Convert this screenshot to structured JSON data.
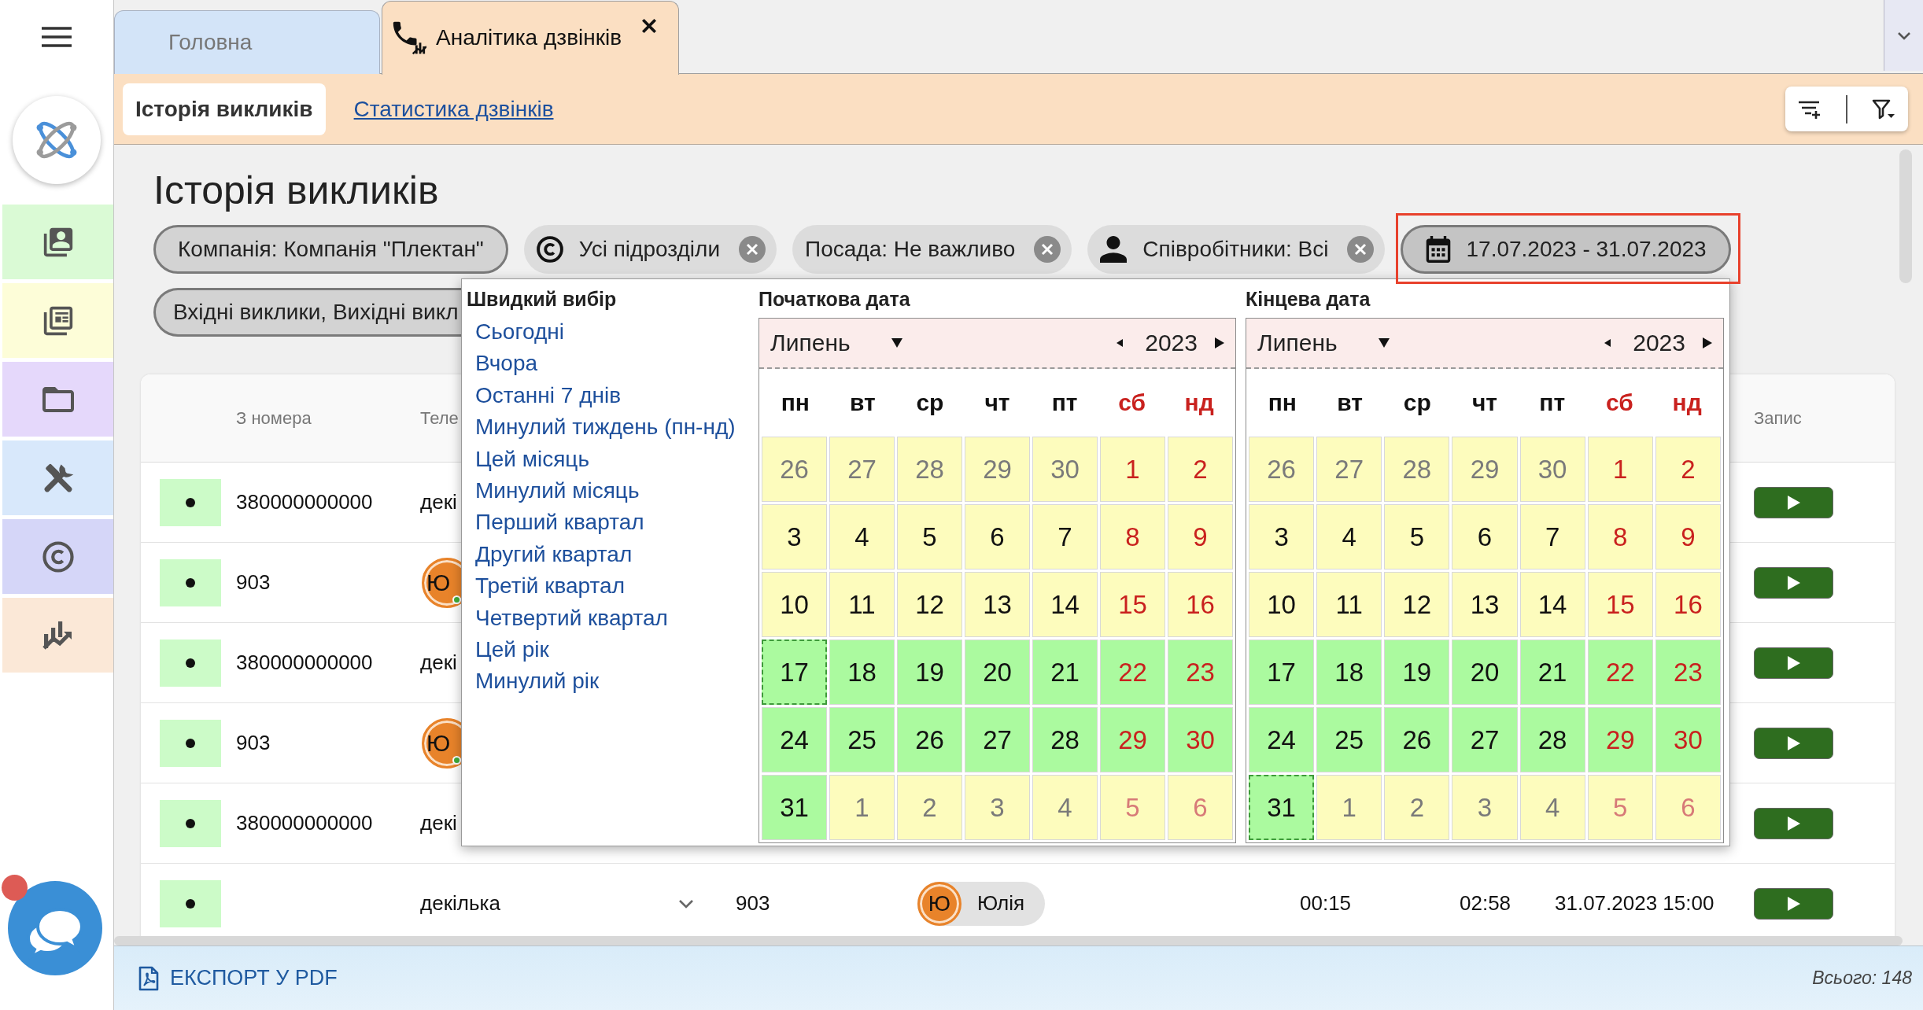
{
  "sidebar": {
    "items": [
      {
        "color": "#dafad5"
      },
      {
        "color": "#fdfdd8"
      },
      {
        "color": "#e5d8fb"
      },
      {
        "color": "#d8e8fb"
      },
      {
        "color": "#d5d6f8"
      },
      {
        "color": "#fbe8d7"
      }
    ]
  },
  "tabs": [
    {
      "label": "Головна",
      "kind": "plain",
      "selected": false,
      "closable": false
    },
    {
      "label": "Аналітика дзвінків",
      "kind": "calls",
      "selected": true,
      "closable": true
    }
  ],
  "subtabs": [
    {
      "label": "Історія викликів",
      "selected": true
    },
    {
      "label": "Статистика дзвінків",
      "selected": false
    }
  ],
  "page_title": "Історія викликів",
  "filters": [
    {
      "kind": "company",
      "label": "Компанія: Компанія \"Плектан\"",
      "removable": false,
      "expanded": false,
      "highlighted": false
    },
    {
      "kind": "division",
      "label": "Усі підрозділи",
      "removable": true,
      "expanded": false,
      "highlighted": false
    },
    {
      "kind": "position",
      "label": "Посада: Не важливо",
      "removable": true,
      "expanded": false,
      "highlighted": false
    },
    {
      "kind": "employees",
      "label": "Співробітники: Всі",
      "removable": true,
      "expanded": false,
      "highlighted": false
    },
    {
      "kind": "period",
      "label": "17.07.2023 - 31.07.2023",
      "removable": false,
      "expanded": true,
      "highlighted": true
    },
    {
      "kind": "call_types",
      "label": "Вхідні виклики, Вихідні викл",
      "removable": false,
      "expanded": false,
      "highlighted": false
    }
  ],
  "date_picker": {
    "quick_select": {
      "title": "Швидкий вибір",
      "items": [
        "Сьогодні",
        "Вчора",
        "Останні 7 днів",
        "Минулий тиждень (пн-нд)",
        "Цей місяць",
        "Минулий місяць",
        "Перший квартал",
        "Другий квартал",
        "Третій квартал",
        "Четвертий квартал",
        "Цей рік",
        "Минулий рік"
      ]
    },
    "calendars": [
      {
        "title": "Початкова дата",
        "month": "Липень",
        "year": "2023",
        "weekdays": [
          {
            "label": "пн",
            "weekend": false
          },
          {
            "label": "вт",
            "weekend": false
          },
          {
            "label": "ср",
            "weekend": false
          },
          {
            "label": "чт",
            "weekend": false
          },
          {
            "label": "пт",
            "weekend": false
          },
          {
            "label": "сб",
            "weekend": true
          },
          {
            "label": "нд",
            "weekend": true
          }
        ],
        "weeks": [
          [
            {
              "day": "26",
              "other_month": true,
              "in_range": false,
              "selected": false
            },
            {
              "day": "27",
              "other_month": true,
              "in_range": false,
              "selected": false
            },
            {
              "day": "28",
              "other_month": true,
              "in_range": false,
              "selected": false
            },
            {
              "day": "29",
              "other_month": true,
              "in_range": false,
              "selected": false
            },
            {
              "day": "30",
              "other_month": true,
              "in_range": false,
              "selected": false
            },
            {
              "day": "1",
              "other_month": false,
              "in_range": false,
              "selected": false
            },
            {
              "day": "2",
              "other_month": false,
              "in_range": false,
              "selected": false
            }
          ],
          [
            {
              "day": "3",
              "other_month": false,
              "in_range": false,
              "selected": false
            },
            {
              "day": "4",
              "other_month": false,
              "in_range": false,
              "selected": false
            },
            {
              "day": "5",
              "other_month": false,
              "in_range": false,
              "selected": false
            },
            {
              "day": "6",
              "other_month": false,
              "in_range": false,
              "selected": false
            },
            {
              "day": "7",
              "other_month": false,
              "in_range": false,
              "selected": false
            },
            {
              "day": "8",
              "other_month": false,
              "in_range": false,
              "selected": false
            },
            {
              "day": "9",
              "other_month": false,
              "in_range": false,
              "selected": false
            }
          ],
          [
            {
              "day": "10",
              "other_month": false,
              "in_range": false,
              "selected": false
            },
            {
              "day": "11",
              "other_month": false,
              "in_range": false,
              "selected": false
            },
            {
              "day": "12",
              "other_month": false,
              "in_range": false,
              "selected": false
            },
            {
              "day": "13",
              "other_month": false,
              "in_range": false,
              "selected": false
            },
            {
              "day": "14",
              "other_month": false,
              "in_range": false,
              "selected": false
            },
            {
              "day": "15",
              "other_month": false,
              "in_range": false,
              "selected": false
            },
            {
              "day": "16",
              "other_month": false,
              "in_range": false,
              "selected": false
            }
          ],
          [
            {
              "day": "17",
              "other_month": false,
              "in_range": true,
              "selected": true
            },
            {
              "day": "18",
              "other_month": false,
              "in_range": true,
              "selected": false
            },
            {
              "day": "19",
              "other_month": false,
              "in_range": true,
              "selected": false
            },
            {
              "day": "20",
              "other_month": false,
              "in_range": true,
              "selected": false
            },
            {
              "day": "21",
              "other_month": false,
              "in_range": true,
              "selected": false
            },
            {
              "day": "22",
              "other_month": false,
              "in_range": true,
              "selected": false
            },
            {
              "day": "23",
              "other_month": false,
              "in_range": true,
              "selected": false
            }
          ],
          [
            {
              "day": "24",
              "other_month": false,
              "in_range": true,
              "selected": false
            },
            {
              "day": "25",
              "other_month": false,
              "in_range": true,
              "selected": false
            },
            {
              "day": "26",
              "other_month": false,
              "in_range": true,
              "selected": false
            },
            {
              "day": "27",
              "other_month": false,
              "in_range": true,
              "selected": false
            },
            {
              "day": "28",
              "other_month": false,
              "in_range": true,
              "selected": false
            },
            {
              "day": "29",
              "other_month": false,
              "in_range": true,
              "selected": false
            },
            {
              "day": "30",
              "other_month": false,
              "in_range": true,
              "selected": false
            }
          ],
          [
            {
              "day": "31",
              "other_month": false,
              "in_range": true,
              "selected": false
            },
            {
              "day": "1",
              "other_month": true,
              "in_range": false,
              "selected": false
            },
            {
              "day": "2",
              "other_month": true,
              "in_range": false,
              "selected": false
            },
            {
              "day": "3",
              "other_month": true,
              "in_range": false,
              "selected": false
            },
            {
              "day": "4",
              "other_month": true,
              "in_range": false,
              "selected": false
            },
            {
              "day": "5",
              "other_month": true,
              "in_range": false,
              "selected": false
            },
            {
              "day": "6",
              "other_month": true,
              "in_range": false,
              "selected": false
            }
          ]
        ]
      },
      {
        "title": "Кінцева дата",
        "month": "Липень",
        "year": "2023",
        "weekdays": [
          {
            "label": "пн",
            "weekend": false
          },
          {
            "label": "вт",
            "weekend": false
          },
          {
            "label": "ср",
            "weekend": false
          },
          {
            "label": "чт",
            "weekend": false
          },
          {
            "label": "пт",
            "weekend": false
          },
          {
            "label": "сб",
            "weekend": true
          },
          {
            "label": "нд",
            "weekend": true
          }
        ],
        "weeks": [
          [
            {
              "day": "26",
              "other_month": true,
              "in_range": false,
              "selected": false
            },
            {
              "day": "27",
              "other_month": true,
              "in_range": false,
              "selected": false
            },
            {
              "day": "28",
              "other_month": true,
              "in_range": false,
              "selected": false
            },
            {
              "day": "29",
              "other_month": true,
              "in_range": false,
              "selected": false
            },
            {
              "day": "30",
              "other_month": true,
              "in_range": false,
              "selected": false
            },
            {
              "day": "1",
              "other_month": false,
              "in_range": false,
              "selected": false
            },
            {
              "day": "2",
              "other_month": false,
              "in_range": false,
              "selected": false
            }
          ],
          [
            {
              "day": "3",
              "other_month": false,
              "in_range": false,
              "selected": false
            },
            {
              "day": "4",
              "other_month": false,
              "in_range": false,
              "selected": false
            },
            {
              "day": "5",
              "other_month": false,
              "in_range": false,
              "selected": false
            },
            {
              "day": "6",
              "other_month": false,
              "in_range": false,
              "selected": false
            },
            {
              "day": "7",
              "other_month": false,
              "in_range": false,
              "selected": false
            },
            {
              "day": "8",
              "other_month": false,
              "in_range": false,
              "selected": false
            },
            {
              "day": "9",
              "other_month": false,
              "in_range": false,
              "selected": false
            }
          ],
          [
            {
              "day": "10",
              "other_month": false,
              "in_range": false,
              "selected": false
            },
            {
              "day": "11",
              "other_month": false,
              "in_range": false,
              "selected": false
            },
            {
              "day": "12",
              "other_month": false,
              "in_range": false,
              "selected": false
            },
            {
              "day": "13",
              "other_month": false,
              "in_range": false,
              "selected": false
            },
            {
              "day": "14",
              "other_month": false,
              "in_range": false,
              "selected": false
            },
            {
              "day": "15",
              "other_month": false,
              "in_range": false,
              "selected": false
            },
            {
              "day": "16",
              "other_month": false,
              "in_range": false,
              "selected": false
            }
          ],
          [
            {
              "day": "17",
              "other_month": false,
              "in_range": true,
              "selected": false
            },
            {
              "day": "18",
              "other_month": false,
              "in_range": true,
              "selected": false
            },
            {
              "day": "19",
              "other_month": false,
              "in_range": true,
              "selected": false
            },
            {
              "day": "20",
              "other_month": false,
              "in_range": true,
              "selected": false
            },
            {
              "day": "21",
              "other_month": false,
              "in_range": true,
              "selected": false
            },
            {
              "day": "22",
              "other_month": false,
              "in_range": true,
              "selected": false
            },
            {
              "day": "23",
              "other_month": false,
              "in_range": true,
              "selected": false
            }
          ],
          [
            {
              "day": "24",
              "other_month": false,
              "in_range": true,
              "selected": false
            },
            {
              "day": "25",
              "other_month": false,
              "in_range": true,
              "selected": false
            },
            {
              "day": "26",
              "other_month": false,
              "in_range": true,
              "selected": false
            },
            {
              "day": "27",
              "other_month": false,
              "in_range": true,
              "selected": false
            },
            {
              "day": "28",
              "other_month": false,
              "in_range": true,
              "selected": false
            },
            {
              "day": "29",
              "other_month": false,
              "in_range": true,
              "selected": false
            },
            {
              "day": "30",
              "other_month": false,
              "in_range": true,
              "selected": false
            }
          ],
          [
            {
              "day": "31",
              "other_month": false,
              "in_range": true,
              "selected": true
            },
            {
              "day": "1",
              "other_month": true,
              "in_range": false,
              "selected": false
            },
            {
              "day": "2",
              "other_month": true,
              "in_range": false,
              "selected": false
            },
            {
              "day": "3",
              "other_month": true,
              "in_range": false,
              "selected": false
            },
            {
              "day": "4",
              "other_month": true,
              "in_range": false,
              "selected": false
            },
            {
              "day": "5",
              "other_month": true,
              "in_range": false,
              "selected": false
            },
            {
              "day": "6",
              "other_month": true,
              "in_range": false,
              "selected": false
            }
          ]
        ]
      }
    ]
  },
  "table": {
    "headers": {
      "from_number": "З номера",
      "column_3": "Теле",
      "column_9": "Запис"
    },
    "rows": [
      {
        "from_number": "380000000000",
        "column_3": {
          "kind": "text",
          "text": "декі"
        }
      },
      {
        "from_number": "903",
        "column_3": {
          "kind": "avatar",
          "initial": "Ю",
          "online": true
        }
      },
      {
        "from_number": "380000000000",
        "column_3": {
          "kind": "text",
          "text": "декі"
        }
      },
      {
        "from_number": "903",
        "column_3": {
          "kind": "avatar",
          "initial": "Ю",
          "online": true
        }
      },
      {
        "from_number": "380000000000",
        "column_3": {
          "kind": "text",
          "text": "декі"
        }
      },
      {
        "column_3": {
          "kind": "text",
          "text": "декілька",
          "expandable": true
        },
        "column_4": "903",
        "column_5": {
          "initial": "Ю",
          "name": "Юлія"
        },
        "column_6": "00:15",
        "column_7": "02:58",
        "column_8": "31.07.2023 15:00"
      }
    ]
  },
  "footer": {
    "export_label": "ЕКСПОРТ У PDF",
    "total": "Всього: 148"
  }
}
